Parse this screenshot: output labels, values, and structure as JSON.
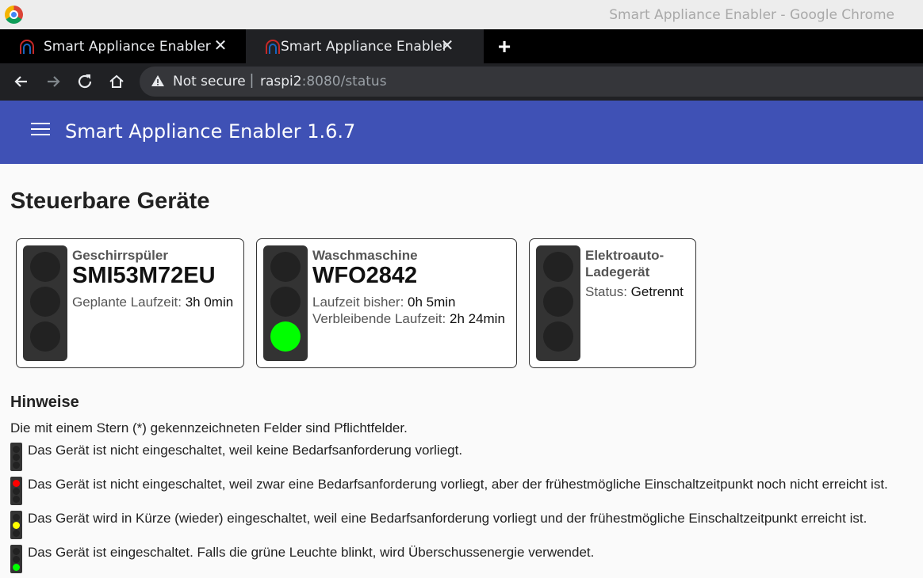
{
  "window": {
    "title": "Smart Appliance Enabler - Google Chrome"
  },
  "tabs": [
    {
      "label": "Smart Appliance Enabler",
      "close": "✕"
    },
    {
      "label": "Smart Appliance Enabler",
      "close": "✕"
    }
  ],
  "new_tab": "+",
  "addressbar": {
    "security_label": "Not secure",
    "separator": "|",
    "host": "raspi2",
    "path": ":8080/status"
  },
  "app": {
    "title": "Smart Appliance Enabler 1.6.7"
  },
  "page": {
    "heading": "Steuerbare Geräte"
  },
  "devices": [
    {
      "type": "Geschirrspüler",
      "model": "SMI53M72EU",
      "lines": [
        {
          "label": "Geplante Laufzeit:",
          "value": "3h 0min"
        }
      ],
      "light": "off"
    },
    {
      "type": "Waschmaschine",
      "model": "WFO2842",
      "lines": [
        {
          "label": "Laufzeit bisher:",
          "value": "0h 5min"
        },
        {
          "label": "Verbleibende Laufzeit:",
          "value": "2h 24min"
        }
      ],
      "light": "green"
    },
    {
      "type_line1": "Elektroauto-",
      "type_line2": "Ladegerät",
      "lines": [
        {
          "label": "Status:",
          "value": "Getrennt"
        }
      ],
      "light": "off"
    }
  ],
  "hints": {
    "heading": "Hinweise",
    "required_note": "Die mit einem Stern (*) gekennzeichneten Felder sind Pflichtfelder.",
    "legend": [
      {
        "light": "off",
        "text": "Das Gerät ist nicht eingeschaltet, weil keine Bedarfsanforderung vorliegt."
      },
      {
        "light": "red",
        "text": "Das Gerät ist nicht eingeschaltet, weil zwar eine Bedarfsanforderung vorliegt, aber der frühestmögliche Einschaltzeitpunkt noch nicht erreicht ist."
      },
      {
        "light": "yellow",
        "text": "Das Gerät wird in Kürze (wieder) eingeschaltet, weil eine Bedarfsanforderung vorliegt und der frühestmögliche Einschaltzeitpunkt erreicht ist."
      },
      {
        "light": "green",
        "text": "Das Gerät ist eingeschaltet. Falls die grüne Leuchte blinkt, wird Überschussenergie verwendet."
      }
    ]
  },
  "colors": {
    "appbar": "#3f51b5",
    "lamp_off": "#222222",
    "lamp_green": "#00ff00",
    "lamp_red": "#ff0000",
    "lamp_yellow": "#ffff00"
  }
}
